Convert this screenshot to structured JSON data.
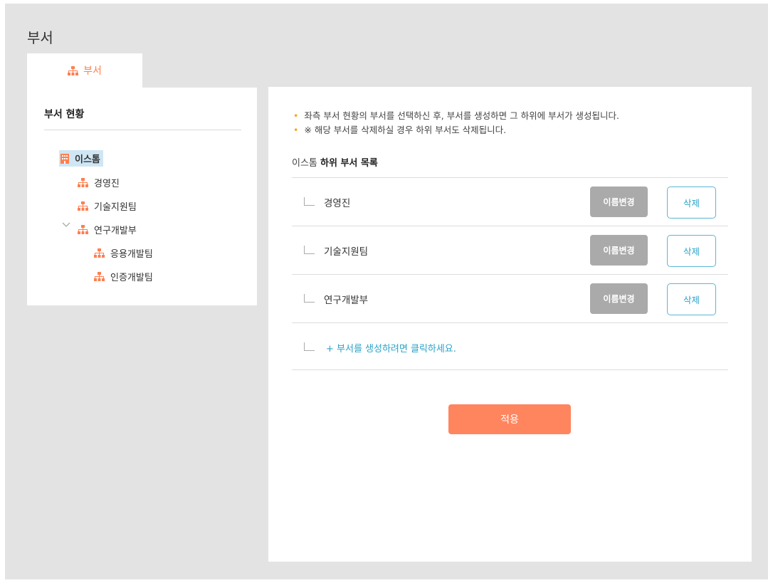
{
  "page": {
    "title": "부서"
  },
  "tab": {
    "label": "부서",
    "icon": "org-chart-icon"
  },
  "left_panel": {
    "title": "부서 현황",
    "tree": {
      "root": {
        "label": "이스톰",
        "icon": "building-icon"
      },
      "children": [
        {
          "label": "경영진",
          "icon": "org-chart-icon"
        },
        {
          "label": "기술지원팀",
          "icon": "org-chart-icon"
        },
        {
          "label": "연구개발부",
          "icon": "org-chart-icon",
          "expanded": true,
          "children": [
            {
              "label": "응용개발팀",
              "icon": "org-chart-icon"
            },
            {
              "label": "인증개발팀",
              "icon": "org-chart-icon"
            }
          ]
        }
      ]
    }
  },
  "right_panel": {
    "notes": [
      "좌측 부서 현황의 부서를 선택하신 후, 부서를 생성하면 그 하위에 부서가 생성됩니다.",
      "※ 해당 부서를 삭제하실 경우 하위 부서도 삭제됩니다."
    ],
    "subtitle_parent": "이스톰",
    "subtitle_suffix": "하위 부서 목록",
    "rows": [
      {
        "name": "경영진",
        "rename_label": "이름변경",
        "delete_label": "삭제"
      },
      {
        "name": "기술지원팀",
        "rename_label": "이름변경",
        "delete_label": "삭제"
      },
      {
        "name": "연구개발부",
        "rename_label": "이름변경",
        "delete_label": "삭제"
      }
    ],
    "add_link": "+ 부서를 생성하려면 클릭하세요.",
    "apply_label": "적용"
  },
  "colors": {
    "accent": "#ff7f50",
    "apply_button": "#ff855f",
    "link": "#2aa3c8",
    "rename_button": "#aaaaaa",
    "bullet": "#f5a623",
    "selected_node": "#cfe6f5",
    "background": "#e3e3e3"
  }
}
